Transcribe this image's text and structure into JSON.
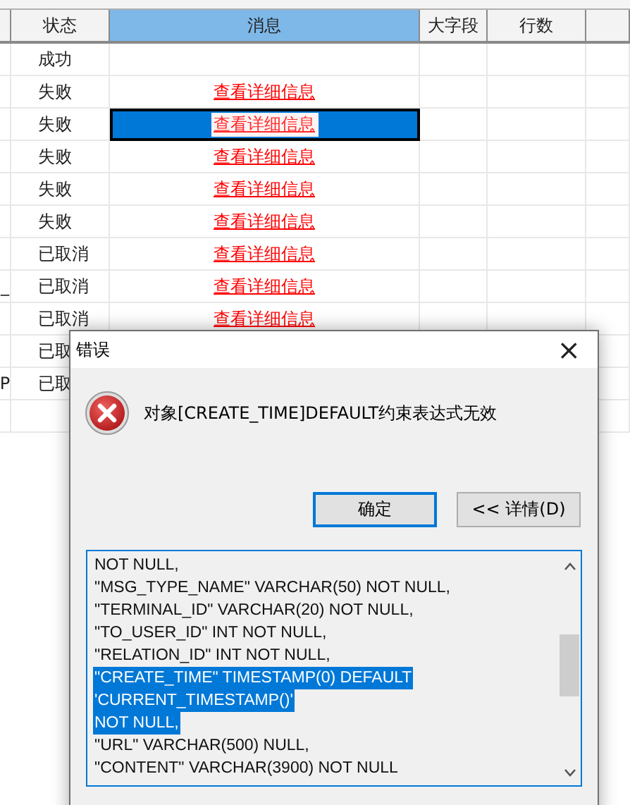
{
  "table": {
    "columns": [
      {
        "label": "状态",
        "selected": false
      },
      {
        "label": "消息",
        "selected": true
      },
      {
        "label": "大字段",
        "selected": false
      },
      {
        "label": "行数",
        "selected": false
      }
    ],
    "rows": [
      {
        "edge": "",
        "status": "成功",
        "message": "",
        "selected": false
      },
      {
        "edge": "",
        "status": "失败",
        "message": "查看详细信息",
        "selected": false
      },
      {
        "edge": "",
        "status": "失败",
        "message": "查看详细信息",
        "selected": true
      },
      {
        "edge": "",
        "status": "失败",
        "message": "查看详细信息",
        "selected": false
      },
      {
        "edge": "",
        "status": "失败",
        "message": "查看详细信息",
        "selected": false
      },
      {
        "edge": "",
        "status": "失败",
        "message": "查看详细信息",
        "selected": false
      },
      {
        "edge": "",
        "status": "已取消",
        "message": "查看详细信息",
        "selected": false
      },
      {
        "edge": "_",
        "status": "已取消",
        "message": "查看详细信息",
        "selected": false
      },
      {
        "edge": "",
        "status": "已取消",
        "message": "查看详细信息",
        "selected": false
      },
      {
        "status": "已取"
      },
      {
        "edge": "P",
        "status": "已取"
      }
    ]
  },
  "dialog": {
    "title": "错误",
    "close": "×",
    "message": "对象[CREATE_TIME]DEFAULT约束表达式无效",
    "buttons": [
      {
        "label": "确定",
        "selected": true
      },
      {
        "label": "<< 详情(D)",
        "selected": false
      }
    ],
    "details": [
      {
        "text": "NOT NULL,",
        "selected": false
      },
      {
        "text": "\"MSG_TYPE_NAME\" VARCHAR(50) NOT NULL,",
        "selected": false
      },
      {
        "text": "\"TERMINAL_ID\" VARCHAR(20) NOT NULL,",
        "selected": false
      },
      {
        "text": "\"TO_USER_ID\" INT NOT NULL,",
        "selected": false
      },
      {
        "text": "\"RELATION_ID\" INT NOT NULL,",
        "selected": false
      },
      {
        "text": "\"CREATE_TIME\" TIMESTAMP(0) DEFAULT",
        "selected": true
      },
      {
        "text": "'CURRENT_TIMESTAMP()'",
        "selected": true
      },
      {
        "text": "NOT NULL,",
        "selected": true
      },
      {
        "text": "\"URL\" VARCHAR(500) NULL,",
        "selected": false
      },
      {
        "text": "\"CONTENT\" VARCHAR(3900) NOT NULL",
        "selected": false
      }
    ]
  }
}
